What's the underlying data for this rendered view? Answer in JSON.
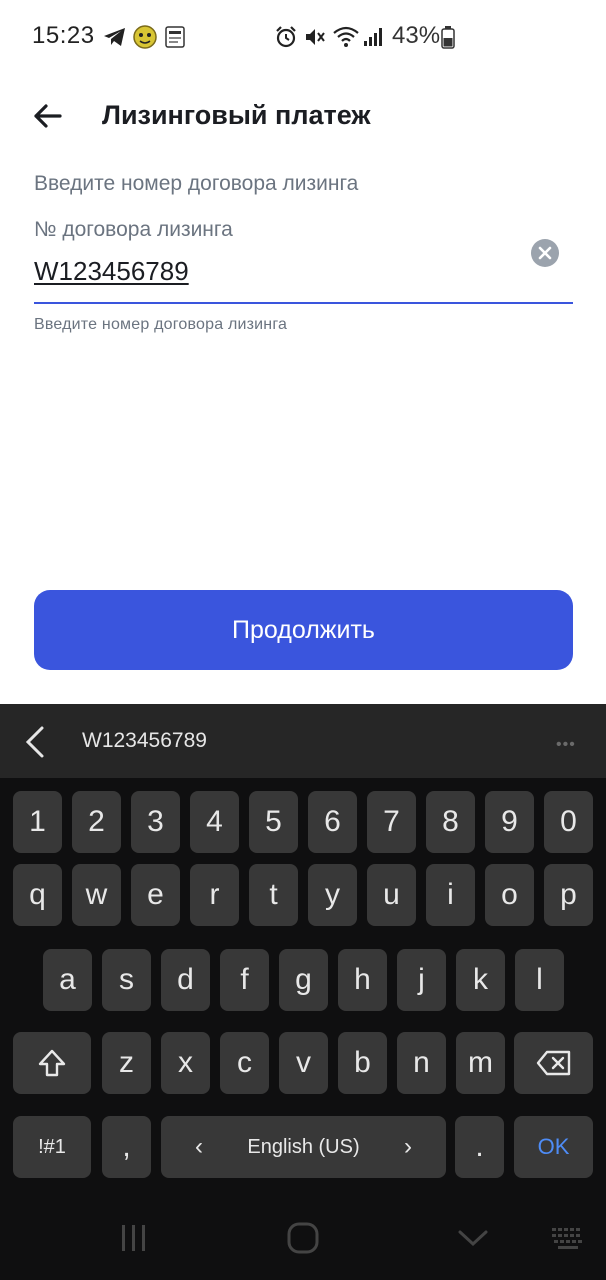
{
  "status_bar": {
    "time": "15:23",
    "battery_percent": "43%",
    "icons": [
      "telegram-icon",
      "sticker-icon",
      "pdf-doc-icon",
      "alarm-icon",
      "vibrate-mute-icon",
      "wifi-icon",
      "signal-icon",
      "battery-icon"
    ]
  },
  "header": {
    "title": "Лизинговый платеж",
    "back_icon": "arrow-left-icon"
  },
  "form": {
    "hint": "Введите номер договора лизинга",
    "field_label": "№ договора лизинга",
    "field_value": "W123456789",
    "helper_text": "Введите номер договора лизинга",
    "clear_icon": "clear-circle-icon"
  },
  "continue_button": {
    "label": "Продолжить"
  },
  "colors": {
    "accent": "#3a55dd",
    "keyboard_bg": "#0f0f10",
    "key_bg": "#383838",
    "ok_text": "#4e8cf6"
  },
  "keyboard": {
    "suggestion": "W123456789",
    "more": "•••",
    "row_numbers": [
      "1",
      "2",
      "3",
      "4",
      "5",
      "6",
      "7",
      "8",
      "9",
      "0"
    ],
    "row_top": [
      "q",
      "w",
      "e",
      "r",
      "t",
      "y",
      "u",
      "i",
      "o",
      "p"
    ],
    "row_home": [
      "a",
      "s",
      "d",
      "f",
      "g",
      "h",
      "j",
      "k",
      "l"
    ],
    "row_bottom": [
      "z",
      "x",
      "c",
      "v",
      "b",
      "n",
      "m"
    ],
    "symbols": "!#1",
    "comma": ",",
    "space_label": "English (US)",
    "space_left": "‹",
    "space_right": "›",
    "period": ".",
    "ok": "OK"
  },
  "nav_bar": {
    "items": [
      "recent-apps-icon",
      "home-icon",
      "back-chevron-icon",
      "keyboard-icon"
    ]
  }
}
